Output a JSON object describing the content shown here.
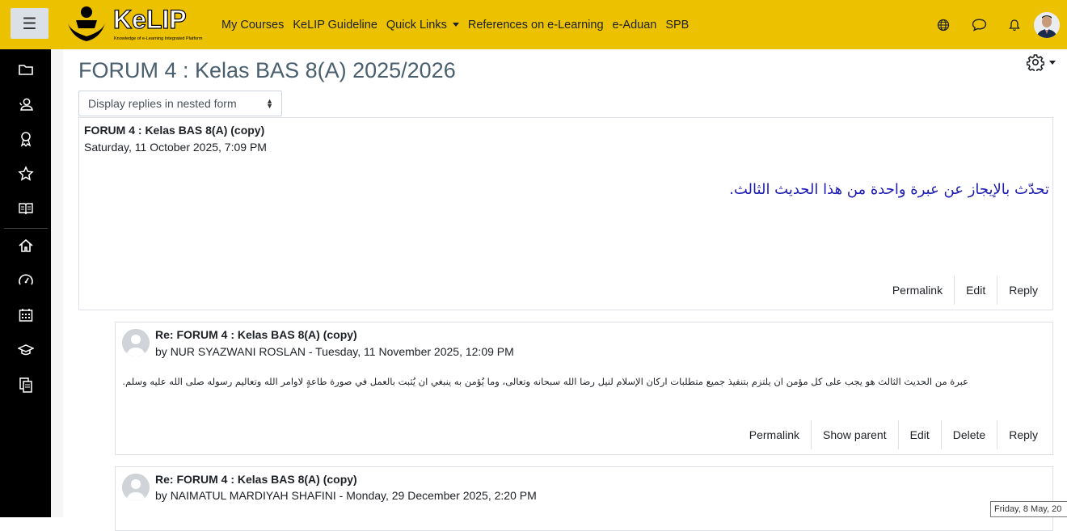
{
  "navbar": {
    "logo_text": "KeLIP",
    "logo_tagline": "Knowledge of e-Learning Integrated Platform",
    "links": [
      {
        "label": "My Courses"
      },
      {
        "label": "KeLIP Guideline"
      },
      {
        "label": "Quick Links",
        "dropdown": true
      },
      {
        "label": "References on e-Learning"
      },
      {
        "label": "e-Aduan"
      },
      {
        "label": "SPB"
      }
    ],
    "icons": [
      "globe-icon",
      "chat-icon",
      "bell-icon"
    ],
    "colors": {
      "bar": "#ecc100"
    }
  },
  "sidebar": {
    "items": [
      "folder-icon",
      "participants-icon",
      "badge-icon",
      "star-icon",
      "book-icon",
      "home-icon",
      "dashboard-icon",
      "calendar-icon",
      "graduation-cap-icon",
      "files-icon"
    ]
  },
  "page": {
    "title": "FORUM 4 : Kelas BAS 8(A) 2025/2026",
    "display_mode": "Display replies in nested form"
  },
  "posts": [
    {
      "subject": "FORUM 4 : Kelas BAS 8(A) (copy)",
      "date": "Saturday, 11 October 2025, 7:09 PM",
      "body": "تحدّث بالإيجاز عن عبرة واحدة من هذا الحديث الثالث.",
      "commands": [
        "Permalink",
        "Edit",
        "Reply"
      ]
    },
    {
      "subject": "Re: FORUM 4 : Kelas BAS 8(A) (copy)",
      "by": "by",
      "author": "NUR SYAZWANI ROSLAN",
      "date": " - Tuesday, 11 November 2025, 12:09 PM",
      "body": "عبرة من الحديث الثالث هو يجب على كل مؤمن ان يلتزم بتنفيذ جميع متطلبات اركان الإسلام لنيل رضا الله سبحانه وتعالى، وما يُؤمن به ينبغي ان يُثبت بالعمل في صورة طاعةٍ لاوامر الله وتعاليم رسوله صلى الله عليه وسلم.",
      "commands": [
        "Permalink",
        "Show parent",
        "Edit",
        "Delete",
        "Reply"
      ]
    },
    {
      "subject": "Re: FORUM 4 : Kelas BAS 8(A) (copy)",
      "by": "by",
      "author": "NAIMATUL MARDIYAH SHAFINI",
      "date": " - Monday, 29 December 2025, 2:20 PM"
    }
  ],
  "tooltip": "Friday, 8 May, 20"
}
